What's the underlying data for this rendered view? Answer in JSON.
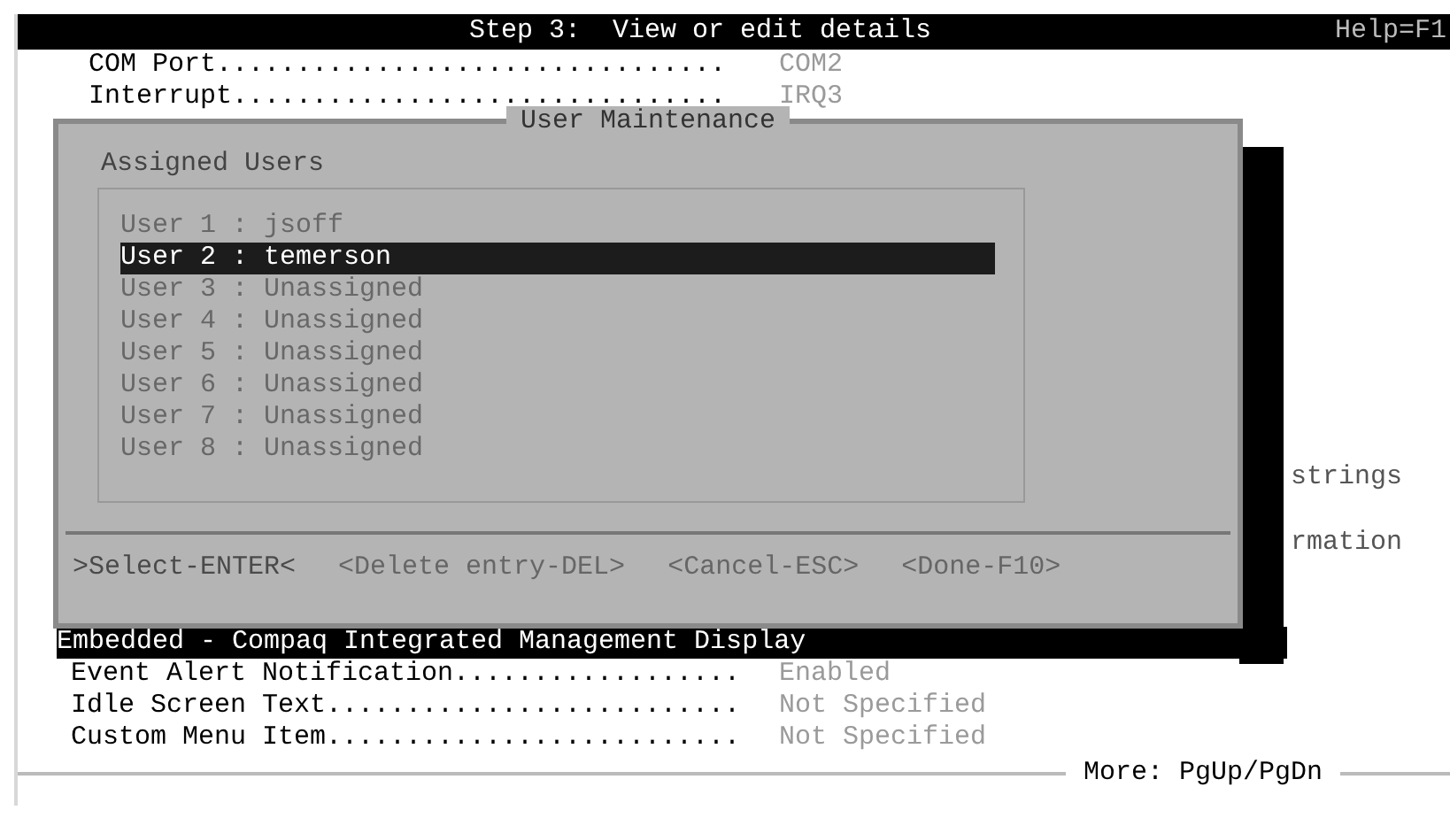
{
  "header": {
    "title": "Step 3:  View or edit details",
    "help": "Help=F1"
  },
  "background_rows": [
    {
      "label": "COM Port................................",
      "value": "COM2"
    },
    {
      "label": "Interrupt...............................",
      "value": "IRQ3"
    }
  ],
  "background_fragments": [
    "strings",
    "rmation"
  ],
  "dialog": {
    "title": "User Maintenance",
    "heading": "Assigned Users",
    "users": [
      {
        "label": "User 1 : jsoff",
        "selected": false
      },
      {
        "label": "User 2 : temerson",
        "selected": true
      },
      {
        "label": "User 3 : Unassigned",
        "selected": false
      },
      {
        "label": "User 4 : Unassigned",
        "selected": false
      },
      {
        "label": "User 5 : Unassigned",
        "selected": false
      },
      {
        "label": "User 6 : Unassigned",
        "selected": false
      },
      {
        "label": "User 7 : Unassigned",
        "selected": false
      },
      {
        "label": "User 8 : Unassigned",
        "selected": false
      }
    ],
    "actions": [
      {
        "label": ">Select-ENTER<",
        "focused": true
      },
      {
        "label": "<Delete entry-DEL>",
        "focused": false
      },
      {
        "label": "<Cancel-ESC>",
        "focused": false
      },
      {
        "label": "<Done-F10>",
        "focused": false
      }
    ]
  },
  "section": {
    "title": "Embedded - Compaq Integrated Management Display",
    "rows": [
      {
        "label": "Event Alert Notification..................",
        "value": "Enabled"
      },
      {
        "label": "Idle Screen Text..........................",
        "value": "Not Specified"
      },
      {
        "label": "Custom Menu Item..........................",
        "value": "Not Specified"
      }
    ]
  },
  "footer": {
    "hint": "More: PgUp/PgDn"
  }
}
